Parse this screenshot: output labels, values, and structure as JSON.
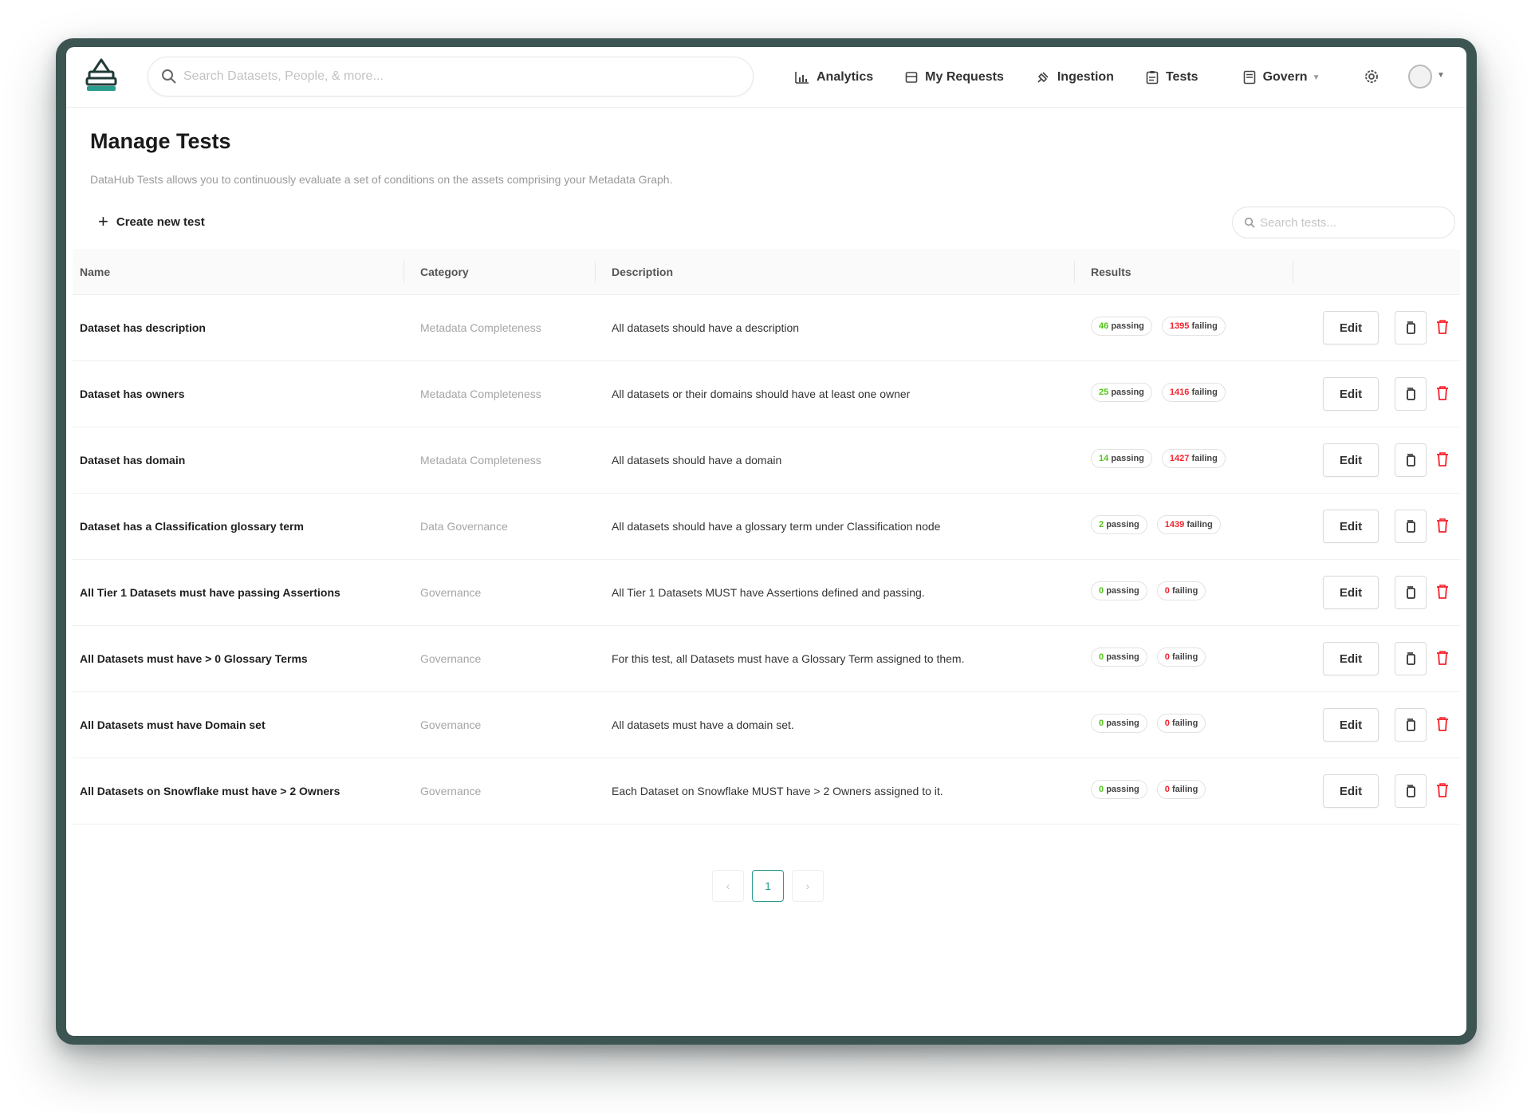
{
  "header": {
    "search_placeholder": "Search Datasets, People, & more...",
    "nav": [
      {
        "label": "Analytics",
        "icon": "bar-chart-icon"
      },
      {
        "label": "My Requests",
        "icon": "inbox-icon"
      },
      {
        "label": "Ingestion",
        "icon": "plug-icon"
      },
      {
        "label": "Tests",
        "icon": "clipboard-icon"
      },
      {
        "label": "Govern",
        "icon": "book-icon"
      }
    ]
  },
  "page": {
    "title": "Manage Tests",
    "description": "DataHub Tests allows you to continuously evaluate a set of conditions on the assets comprising your Metadata Graph.",
    "create_label": "Create new test",
    "search_placeholder": "Search tests..."
  },
  "table": {
    "columns": [
      "Name",
      "Category",
      "Description",
      "Results"
    ],
    "rows": [
      {
        "name": "Dataset has description",
        "category": "Metadata Completeness",
        "description": "All datasets should have a description",
        "passing": "46",
        "failing": "1395"
      },
      {
        "name": "Dataset has owners",
        "category": "Metadata Completeness",
        "description": "All datasets or their domains should have at least one owner",
        "passing": "25",
        "failing": "1416"
      },
      {
        "name": "Dataset has domain",
        "category": "Metadata Completeness",
        "description": "All datasets should have a domain",
        "passing": "14",
        "failing": "1427"
      },
      {
        "name": "Dataset has a Classification glossary term",
        "category": "Data Governance",
        "description": "All datasets should have a glossary term under Classification node",
        "passing": "2",
        "failing": "1439"
      },
      {
        "name": "All Tier 1 Datasets must have passing Assertions",
        "category": "Governance",
        "description": "All Tier 1 Datasets MUST have Assertions defined and passing.",
        "passing": "0",
        "failing": "0"
      },
      {
        "name": "All Datasets must have > 0 Glossary Terms",
        "category": "Governance",
        "description": "For this test, all Datasets must have a Glossary Term assigned to them.",
        "passing": "0",
        "failing": "0"
      },
      {
        "name": "All Datasets must have Domain set",
        "category": "Governance",
        "description": "All datasets must have a domain set.",
        "passing": "0",
        "failing": "0"
      },
      {
        "name": "All Datasets on Snowflake must have > 2 Owners",
        "category": "Governance",
        "description": "Each Dataset on Snowflake MUST have > 2 Owners assigned to it.",
        "passing": "0",
        "failing": "0"
      }
    ],
    "passing_suffix": "passing",
    "failing_suffix": "failing",
    "edit_label": "Edit"
  },
  "pagination": {
    "current": "1",
    "prev": "‹",
    "next": "›"
  },
  "colors": {
    "accent": "#2a9d8f",
    "passing": "#52c41a",
    "failing": "#f5222d",
    "frame": "#3d5552"
  }
}
